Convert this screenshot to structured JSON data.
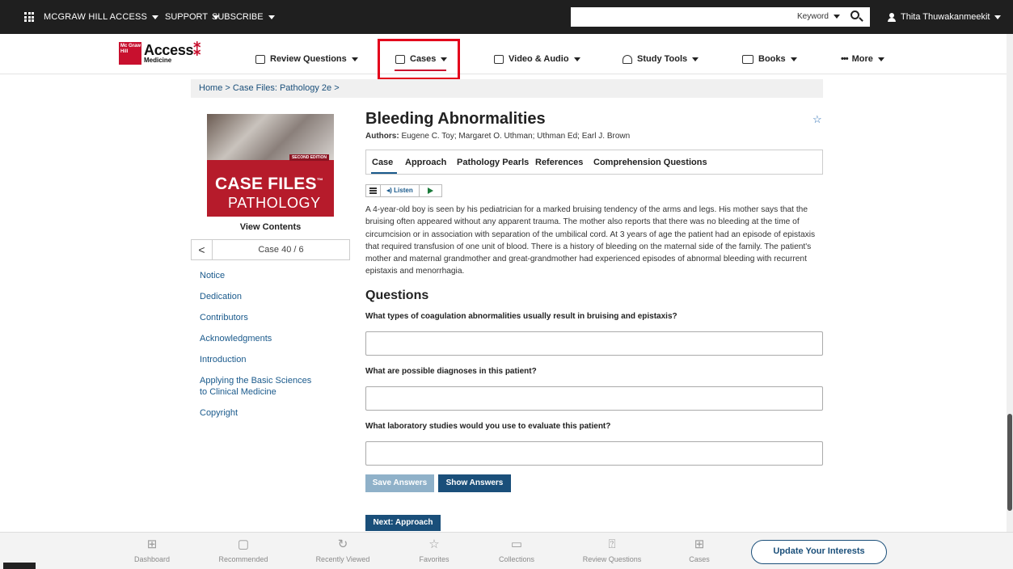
{
  "topbar": {
    "brand_label": "MCGRAW HILL ACCESS",
    "support_label": "SUPPORT",
    "subscribe_label": "SUBSCRIBE",
    "search_placeholder": "",
    "search_mode": "Keyword",
    "user_name": "Thita Thuwakanmeekit"
  },
  "logo": {
    "mgh_text": "Mc Graw Hill",
    "access_text": "Access",
    "sub_text": "Medicine"
  },
  "nav": {
    "items": [
      {
        "label": "Review Questions",
        "icon": "review-questions-icon"
      },
      {
        "label": "Cases",
        "icon": "cases-icon"
      },
      {
        "label": "Video & Audio",
        "icon": "video-icon"
      },
      {
        "label": "Study Tools",
        "icon": "study-tools-icon"
      },
      {
        "label": "Books",
        "icon": "books-icon"
      },
      {
        "label": "More",
        "icon": "more-icon"
      }
    ],
    "active": "Cases"
  },
  "breadcrumb": "Home > Case Files: Pathology 2e >",
  "book": {
    "edition_label": "SECOND EDITION",
    "cover_title": "CASE FILES",
    "cover_trademark": "™",
    "cover_subtitle": "PATHOLOGY",
    "view_contents": "View Contents",
    "case_position": "Case 40 / 6",
    "prev_glyph": "<"
  },
  "toc": [
    "Notice",
    "Dedication",
    "Contributors",
    "Acknowledgments",
    "Introduction",
    "Applying the Basic Sciences to Clinical Medicine",
    "Copyright"
  ],
  "article": {
    "title": "Bleeding Abnormalities",
    "authors_label": "Authors:",
    "authors": "Eugene C. Toy; Margaret O. Uthman; Uthman Ed; Earl J. Brown",
    "tabs": [
      "Case",
      "Approach",
      "Pathology Pearls",
      "References",
      "Comprehension Questions"
    ],
    "active_tab": "Case",
    "listen_label": "Listen",
    "case_text": "A 4-year-old boy is seen by his pediatrician for a marked bruising tendency of the arms and legs. His mother says that the bruising often appeared without any apparent trauma. The mother also reports that there was no bleeding at the time of circumcision or in association with separation of the umbilical cord. At 3 years of age the patient had an episode of epistaxis that required transfusion of one unit of blood. There is a history of bleeding on the maternal side of the family. The patient's mother and maternal grandmother and great-grandmother had experienced episodes of abnormal bleeding with recurrent epistaxis and menorrhagia.",
    "questions_heading": "Questions",
    "questions": [
      "What types of coagulation abnormalities usually result in bruising and epistaxis?",
      "What are possible diagnoses in this patient?",
      "What laboratory studies would you use to evaluate this patient?"
    ],
    "save_label": "Save Answers",
    "show_label": "Show Answers",
    "next_label": "Next: Approach"
  },
  "dock": {
    "items": [
      {
        "label": "Dashboard",
        "icon": "dashboard-icon"
      },
      {
        "label": "Recommended",
        "icon": "recommended-icon"
      },
      {
        "label": "Recently Viewed",
        "icon": "history-icon"
      },
      {
        "label": "Favorites",
        "icon": "star-icon"
      },
      {
        "label": "Collections",
        "icon": "folder-icon"
      },
      {
        "label": "Review Questions",
        "icon": "review-questions-icon"
      },
      {
        "label": "Cases",
        "icon": "cases-icon"
      }
    ],
    "update_label": "Update Your Interests"
  },
  "colors": {
    "brand_red": "#c8102e",
    "link_blue": "#1a5a8c",
    "button_blue": "#1a4f7a",
    "highlight_red": "#e3001b"
  }
}
